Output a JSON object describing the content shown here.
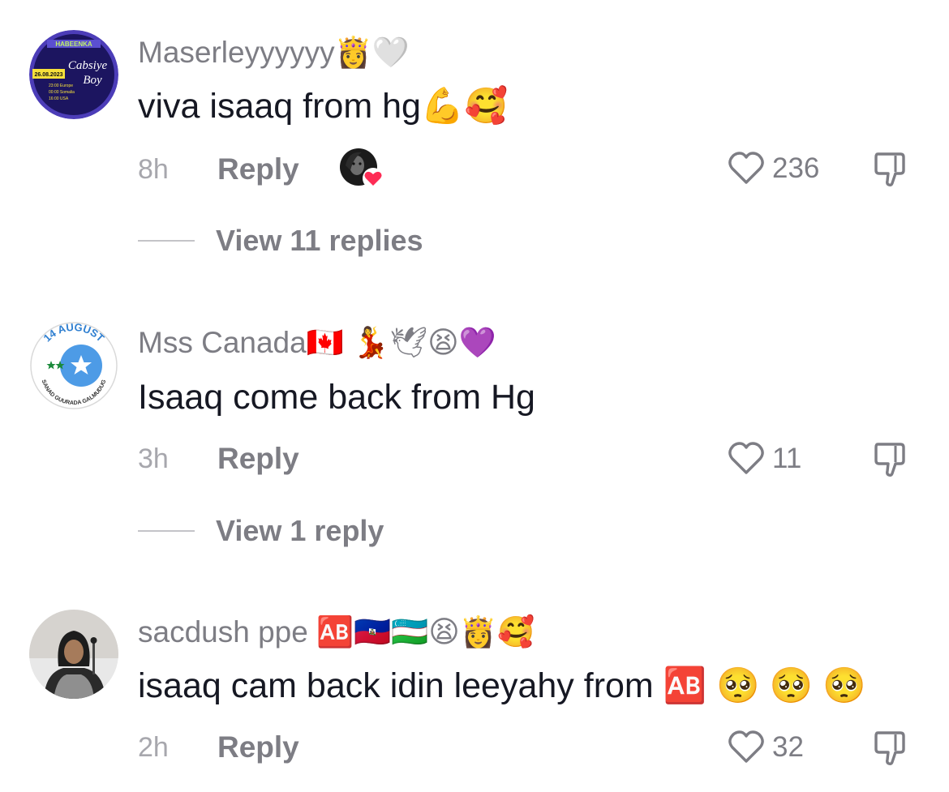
{
  "comments": [
    {
      "username": "Maserleyyyyyy👸🤍",
      "text": "viva isaaq from hg💪🥰",
      "time": "8h",
      "reply_label": "Reply",
      "likes": "236",
      "view_replies": "View 11 replies",
      "avatar_text": {
        "line1": "HABEENKA",
        "date": "26.08.2023",
        "brand1": "Cabsiye",
        "brand2": "Boy",
        "sched1": "23:00  Europe",
        "sched2": "00:00  Somalia",
        "sched3": "16:00  USA"
      }
    },
    {
      "username": "Mss Canada🇨🇦 💃🕊😫💜",
      "text": "Isaaq come back from Hg",
      "time": "3h",
      "reply_label": "Reply",
      "likes": "11",
      "view_replies": "View 1 reply",
      "avatar_text": {
        "top": "14 AUGUST",
        "bottom": "SANAD GUURADA GALMUDUG"
      }
    },
    {
      "username": "sacdush ppe 🆎🇭🇹🇺🇿😫👸🥰",
      "text": "isaaq cam back idin leeyahy from 🆎 🥺 🥺 🥺",
      "time": "2h",
      "reply_label": "Reply",
      "likes": "32"
    }
  ],
  "icons": {
    "like": "heart-outline-icon",
    "dislike": "thumbs-down-outline-icon",
    "creator_liked": "creator-liked-heart-icon"
  },
  "colors": {
    "primary_text": "#161823",
    "secondary_text": "#7d7d84",
    "time_text": "#a7a7ad",
    "creator_heart": "#fe2c55"
  }
}
